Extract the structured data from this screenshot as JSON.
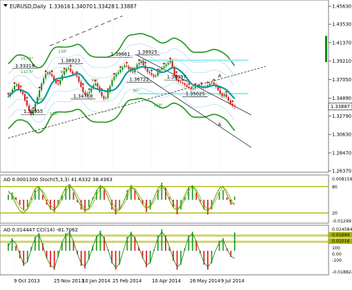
{
  "header": {
    "title": "EURUSD,Daily",
    "ohlc": [
      "1.33616",
      "1.34070",
      "1.33428",
      "1.33887"
    ]
  },
  "colors": {
    "background": "#ffffff",
    "grid": "#d0d0d0",
    "ma_main": "#009a9a",
    "envelope_outer": "#2e9b2e",
    "envelope_inner": "#b4dcf0",
    "cyan_level": "#9fe8ee",
    "candle_up": "#1f8f1f",
    "candle_down": "#d02020",
    "stoch_main": "#7a9a00",
    "stoch_signal": "#55a800",
    "ao_up": "#28a028",
    "ao_down": "#e02020",
    "cci_line": "#228b22",
    "level_band": "#aab400",
    "price_tag_bg": "#ffffff",
    "green_bar": "#0a8a0a"
  },
  "chart_data": [
    {
      "type": "line",
      "name": "main-price-chart",
      "title": "EURUSD,Daily",
      "x": [
        "9 Oct 2013",
        "25 Nov 2013",
        "10 Jan 2014",
        "25 Feb 2014",
        "10 Apr 2014",
        "26 May 2014",
        "9 Jul 2014"
      ],
      "y_axis_ticks": [
        "1.45630",
        "1.43530",
        "1.41370",
        "1.39210",
        "1.37050",
        "1.34890",
        "1.32790",
        "1.30630",
        "1.28470",
        "1.26370"
      ],
      "ylim": [
        1.2637,
        1.462
      ],
      "current_price": "1.33887",
      "close_series": [
        1.351,
        1.3545,
        1.359,
        1.3632,
        1.365,
        1.3592,
        1.356,
        1.3535,
        1.346,
        1.34,
        1.334,
        1.3296,
        1.334,
        1.342,
        1.35,
        1.358,
        1.366,
        1.372,
        1.377,
        1.379,
        1.377,
        1.3745,
        1.37,
        1.366,
        1.365,
        1.37,
        1.376,
        1.38,
        1.383,
        1.3835,
        1.38,
        1.377,
        1.376,
        1.374,
        1.368,
        1.362,
        1.356,
        1.353,
        1.3545,
        1.356,
        1.36,
        1.364,
        1.366,
        1.362,
        1.356,
        1.351,
        1.348,
        1.349,
        1.356,
        1.363,
        1.37,
        1.374,
        1.377,
        1.379,
        1.382,
        1.385,
        1.387,
        1.386,
        1.383,
        1.38,
        1.379,
        1.383,
        1.388,
        1.39,
        1.392,
        1.387,
        1.383,
        1.3795,
        1.378,
        1.376,
        1.374,
        1.375,
        1.379,
        1.382,
        1.384,
        1.386,
        1.388,
        1.39,
        1.392,
        1.385,
        1.376,
        1.37,
        1.368,
        1.367,
        1.366,
        1.364,
        1.362,
        1.361,
        1.359,
        1.36,
        1.362,
        1.364,
        1.363,
        1.362,
        1.361,
        1.362,
        1.364,
        1.366,
        1.367,
        1.365,
        1.362,
        1.358,
        1.354,
        1.351,
        1.353,
        1.35,
        1.346,
        1.342,
        1.34,
        1.3389
      ],
      "price_labels": [
        "1.32955",
        "1.33318",
        "1.38923",
        "1.34768",
        "1.39661",
        "1.36722",
        "1.39925",
        "1.36997",
        "1.35025"
      ],
      "angle_labels": [
        "157.5°",
        "112.5°",
        "90°",
        "90°",
        "138°",
        "138°",
        "90°",
        "90°",
        "90°",
        "138°",
        "90°"
      ],
      "wave_labels": [
        "A",
        "A"
      ],
      "horizontal_levels": [
        1.393,
        1.354
      ]
    },
    {
      "type": "line",
      "name": "stochastic-panel",
      "label": "AO 0.0001300  Stoch(5,3,3) 41.6332 38.4363",
      "series": [
        {
          "name": "Stoch main",
          "values": [
            70,
            60,
            40,
            25,
            20,
            30,
            55,
            75,
            80,
            65,
            45,
            30,
            25,
            40,
            60,
            78,
            85,
            70,
            50,
            35,
            25,
            30,
            50,
            70,
            82,
            75,
            55,
            35,
            22,
            28,
            45,
            65,
            80,
            72,
            55,
            40,
            30,
            35,
            55,
            75,
            84,
            70,
            50,
            32,
            26,
            38,
            60,
            78,
            82,
            68,
            45,
            30,
            24,
            36,
            58,
            76,
            80,
            62,
            42,
            41
          ]
        },
        {
          "name": "Stoch signal",
          "values": [
            65,
            62,
            50,
            35,
            25,
            28,
            45,
            65,
            76,
            70,
            55,
            38,
            30,
            35,
            50,
            68,
            80,
            75,
            60,
            42,
            30,
            28,
            40,
            60,
            76,
            78,
            65,
            45,
            30,
            27,
            38,
            56,
            74,
            76,
            62,
            48,
            36,
            34,
            46,
            65,
            80,
            76,
            60,
            42,
            30,
            33,
            50,
            70,
            80,
            74,
            56,
            38,
            28,
            32,
            48,
            68,
            78,
            70,
            52,
            38
          ]
        }
      ],
      "ao_histogram": [
        0.002,
        0.003,
        0.001,
        -0.002,
        -0.004,
        -0.003,
        0.001,
        0.004,
        0.005,
        0.002,
        -0.002,
        -0.004,
        -0.005,
        -0.002,
        0.002,
        0.005,
        0.006,
        0.003,
        -0.001,
        -0.004,
        -0.005,
        -0.003,
        0.001,
        0.004,
        0.006,
        0.004,
        0.0,
        -0.004,
        -0.006,
        -0.004,
        0.0,
        0.004,
        0.006,
        0.004,
        0.001,
        -0.002,
        -0.005,
        -0.004,
        0.0,
        0.004,
        0.007,
        0.005,
        0.001,
        -0.003,
        -0.006,
        -0.004,
        0.001,
        0.005,
        0.006,
        0.003,
        -0.001,
        -0.004,
        -0.006,
        -0.004,
        0.0,
        0.003,
        0.004,
        0.001,
        -0.002,
        0.0013
      ],
      "levels": [
        80,
        20
      ],
      "y_axis_ticks": [
        "0.008159",
        "80",
        "20",
        "-0.012993"
      ]
    },
    {
      "type": "line",
      "name": "cci-panel",
      "label": "AO 0.014447  CCI(14) -81.7062",
      "series": [
        {
          "name": "CCI(14)",
          "values": [
            50,
            120,
            80,
            -40,
            -150,
            -120,
            20,
            140,
            180,
            60,
            -80,
            -160,
            -190,
            -60,
            90,
            170,
            200,
            100,
            -30,
            -140,
            -170,
            -90,
            40,
            150,
            200,
            130,
            10,
            -120,
            -190,
            -140,
            0,
            130,
            190,
            140,
            40,
            -70,
            -160,
            -130,
            10,
            140,
            210,
            150,
            40,
            -90,
            -180,
            -140,
            20,
            150,
            190,
            100,
            -20,
            -130,
            -180,
            -120,
            0,
            90,
            120,
            20,
            -60,
            -82
          ]
        }
      ],
      "ao_histogram": [
        0.006,
        0.01,
        0.004,
        -0.006,
        -0.012,
        -0.009,
        0.003,
        0.011,
        0.014,
        0.006,
        -0.006,
        -0.013,
        -0.015,
        -0.005,
        0.007,
        0.014,
        0.016,
        0.008,
        -0.003,
        -0.012,
        -0.014,
        -0.007,
        0.004,
        0.012,
        0.016,
        0.011,
        0.001,
        -0.01,
        -0.015,
        -0.011,
        0.0,
        0.011,
        0.015,
        0.011,
        0.003,
        -0.006,
        -0.013,
        -0.01,
        0.001,
        0.012,
        0.017,
        0.012,
        0.003,
        -0.008,
        -0.015,
        -0.011,
        0.002,
        0.012,
        0.015,
        0.008,
        -0.002,
        -0.011,
        -0.015,
        -0.01,
        0.0,
        0.008,
        0.01,
        0.002,
        -0.005,
        0.014447
      ],
      "y_axis_ticks": [
        "0.024584",
        "0.01694",
        "0.01016",
        "100",
        "0.00",
        "-100",
        "-0.018824"
      ]
    }
  ]
}
